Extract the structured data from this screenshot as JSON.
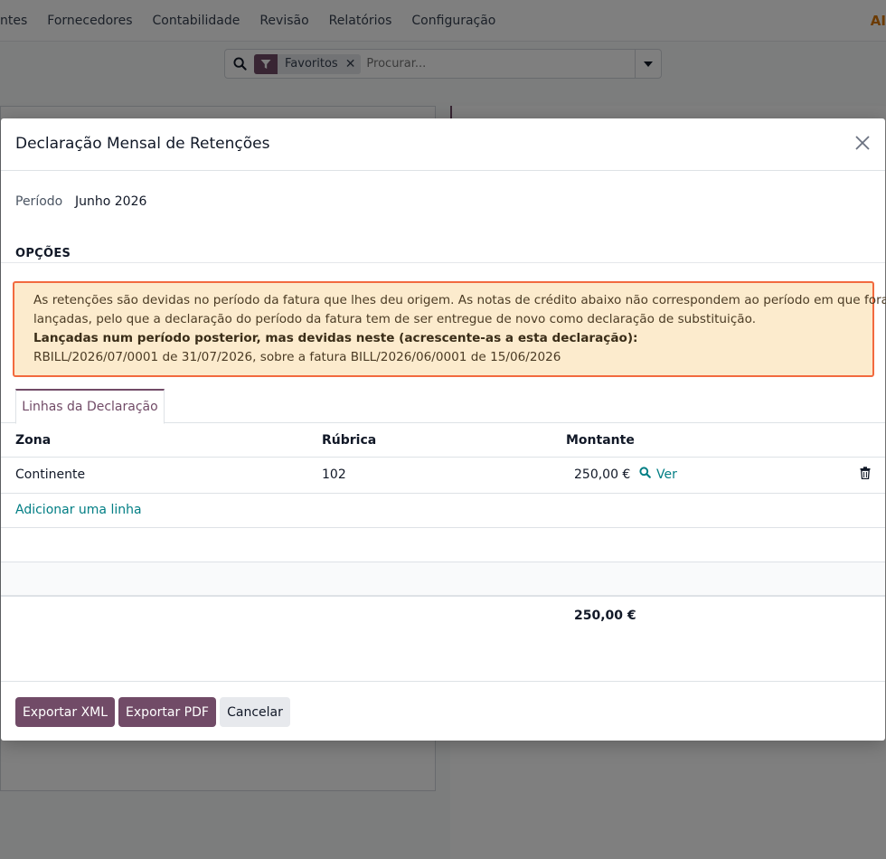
{
  "topnav": {
    "items": [
      "ntes",
      "Fornecedores",
      "Contabilidade",
      "Revisão",
      "Relatórios",
      "Configuração"
    ],
    "logo_text": "AI"
  },
  "search": {
    "facet_label": "Favoritos",
    "placeholder": "Procurar...",
    "icons": [
      "search-icon",
      "filter-icon",
      "close-icon",
      "caret-down-icon"
    ]
  },
  "modal": {
    "title": "Declaração Mensal de Retenções",
    "period_label": "Período",
    "period_value": "Junho 2026",
    "section_title": "OPÇÕES",
    "alert": {
      "line1": "As retenções são devidas no período da fatura que lhes deu origem. As notas de crédito abaixo não correspondem ao período em que foram",
      "line2": "lançadas, pelo que a declaração do período da fatura tem de ser entregue de novo como declaração de substituição.",
      "line3": "Lançadas num período posterior, mas devidas neste (acrescente-as a esta declaração):",
      "line4": "RBILL/2026/07/0001 de 31/07/2026, sobre a fatura BILL/2026/06/0001 de 15/06/2026",
      "border_color": "#f26a3f",
      "background": "#fcebcd"
    },
    "tab_label": "Linhas da Declaração",
    "columns": {
      "zona": "Zona",
      "rubrica": "Rúbrica",
      "montante": "Montante"
    },
    "rows": [
      {
        "zona": "Continente",
        "rubrica": "102",
        "montante": "250,00 €",
        "action": "Ver"
      }
    ],
    "add_line": "Adicionar uma linha",
    "total": "250,00 €",
    "buttons": {
      "export_xml": "Exportar XML",
      "export_pdf": "Exportar PDF",
      "cancel": "Cancelar"
    }
  },
  "colors": {
    "brand": "#714b67",
    "link": "#017e84"
  }
}
